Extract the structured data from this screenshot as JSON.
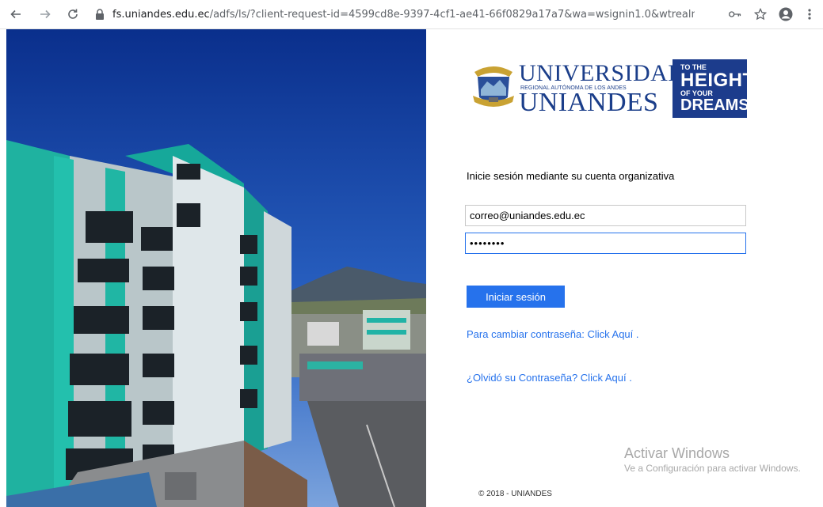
{
  "browser": {
    "url_host": "fs.uniandes.edu.ec",
    "url_rest": "/adfs/ls/?client-request-id=4599cd8e-9397-4cf1-ae41-66f0829a17a7&wa=wsignin1.0&wtrealm=ur...",
    "icons": [
      "back-arrow-icon",
      "forward-arrow-icon",
      "reload-icon",
      "lock-icon",
      "key-icon",
      "star-icon",
      "profile-icon",
      "menu-dots-icon"
    ]
  },
  "logo": {
    "name_top": "UNIVERSIDAD",
    "name_sub": "REGIONAL AUTÓNOMA DE LOS ANDES",
    "name_bottom": "UNIANDES",
    "tagline_1": "TO THE",
    "tagline_2": "HEIGHT",
    "tagline_3": "OF YOUR",
    "tagline_4": "DREAMS"
  },
  "form": {
    "heading": "Inicie sesión mediante su cuenta organizativa",
    "username_value": "correo@uniandes.edu.ec",
    "password_value": "••••••••",
    "submit_label": "Iniciar sesión"
  },
  "links": {
    "change_password": "Para cambiar contraseña: Click Aquí",
    "forgot_password": "¿Olvidó su Contraseña? Click Aquí",
    "dot": "."
  },
  "footer": "© 2018 - UNIANDES",
  "watermark": {
    "title": "Activar Windows",
    "subtitle": "Ve a Configuración para activar Windows."
  },
  "colors": {
    "brand_blue": "#1b3e8a",
    "accent": "#2672ec"
  }
}
